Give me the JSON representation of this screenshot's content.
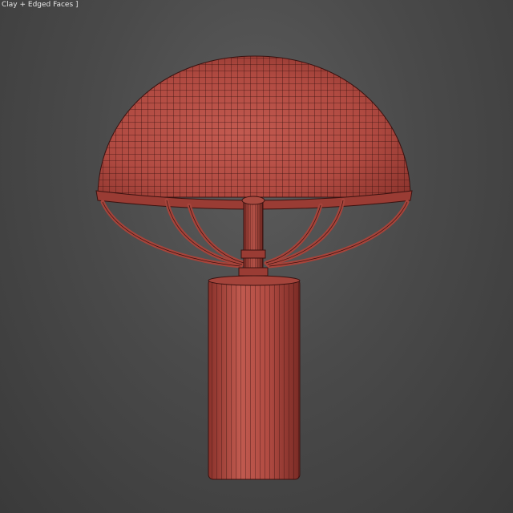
{
  "viewport": {
    "label": "Clay + Edged Faces ]",
    "background": "#4a4a4a"
  },
  "model": {
    "name": "table-lamp",
    "clay_color": "#b64c42",
    "edge_color": "#3a1210"
  }
}
